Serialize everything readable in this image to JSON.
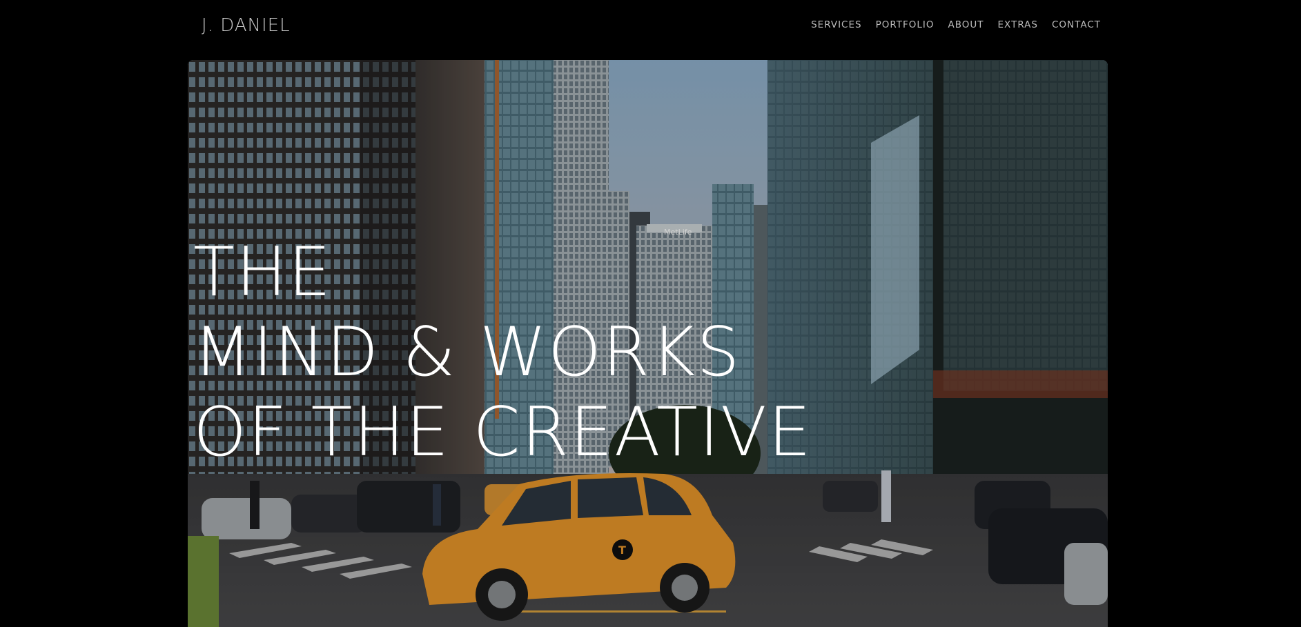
{
  "header": {
    "logo": "J. DANIEL",
    "nav": [
      {
        "label": "SERVICES"
      },
      {
        "label": "PORTFOLIO"
      },
      {
        "label": "ABOUT"
      },
      {
        "label": "EXTRAS"
      },
      {
        "label": "CONTACT"
      }
    ]
  },
  "hero": {
    "title_lines": [
      "THE",
      "MIND & WORKS",
      "OF THE CREATIVE"
    ],
    "image_description": "city-street-photo",
    "sign_text": "MetLife",
    "taxi_logo": "T"
  },
  "colors": {
    "background": "#000000",
    "nav_text": "#bdbdbd",
    "title_text": "#ffffff",
    "taxi": "#e8962a"
  }
}
